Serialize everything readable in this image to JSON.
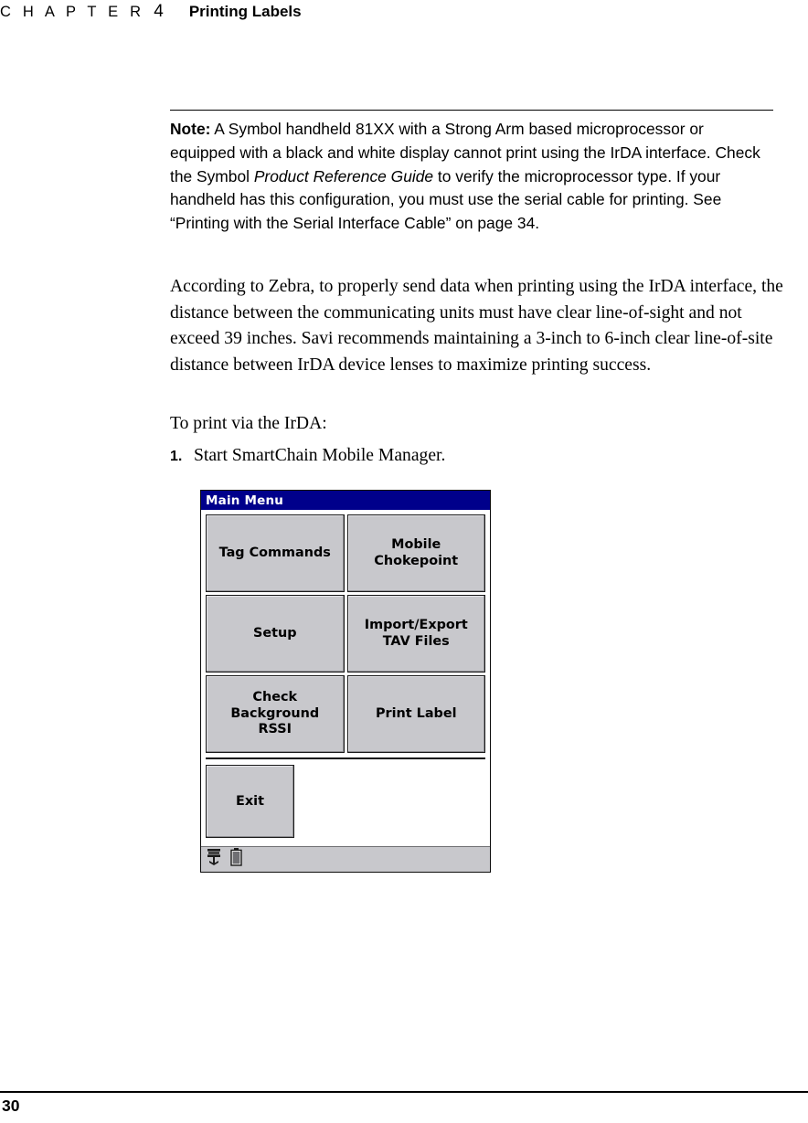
{
  "running_head": {
    "chapter_word": "C H A P T E R",
    "chapter_number": "4",
    "chapter_title": "Printing Labels"
  },
  "note": {
    "label": "Note:",
    "text_part1": " A Symbol handheld 81XX with a Strong Arm based microprocessor or equipped with a black and white display cannot print using the IrDA interface. Check the Symbol ",
    "italic_title": "Product Reference Guide",
    "text_part2": " to verify the microprocessor type. If your handheld has this configuration, you must use the serial cable for printing. See “Printing with the Serial Interface Cable” on page 34."
  },
  "body": {
    "paragraph_zebra": "According to Zebra, to properly send data when printing using the IrDA interface, the distance between the communicating units must have clear line-of-sight and not exceed 39 inches. Savi recommends maintaining a 3-inch to 6-inch clear line-of-site distance between IrDA device lenses to maximize printing success.",
    "paragraph_toprint": "To print via the IrDA:",
    "step_number": "1.",
    "step_text": "Start SmartChain Mobile Manager."
  },
  "device_screenshot": {
    "title": "Main Menu",
    "buttons": [
      {
        "label": "Tag Commands"
      },
      {
        "label": "Mobile\nChokepoint"
      },
      {
        "label": "Setup"
      },
      {
        "label": "Import/Export\nTAV Files"
      },
      {
        "label": "Check\nBackground\nRSSI"
      },
      {
        "label": "Print Label"
      }
    ],
    "exit_button": "Exit",
    "status_icons": [
      "antenna-icon",
      "battery-icon"
    ],
    "colors": {
      "titlebar": "#00008b",
      "button_face": "#c8c8cc",
      "status_bar": "#c8c8cc"
    }
  },
  "footer": {
    "page_number": "30"
  }
}
